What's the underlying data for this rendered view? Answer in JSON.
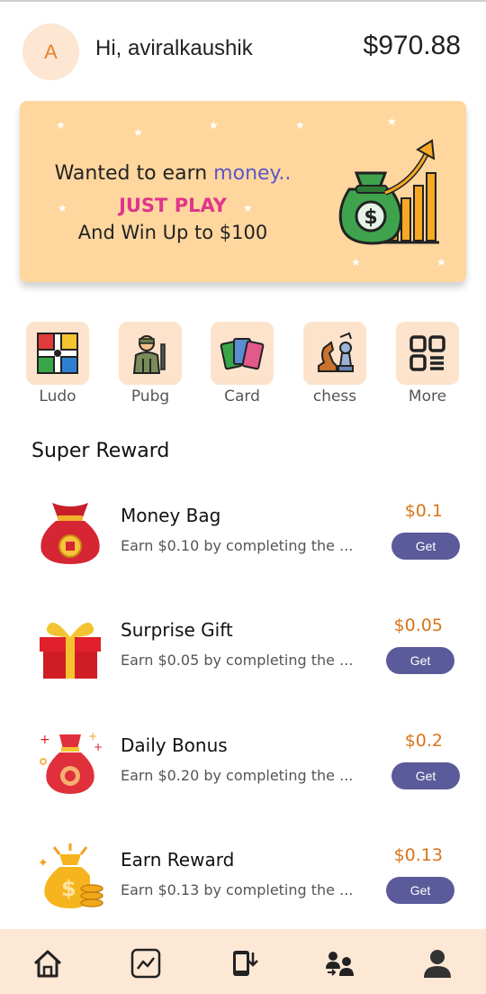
{
  "header": {
    "avatar_letter": "A",
    "greeting": "Hi, aviralkaushik",
    "balance": "$970.88"
  },
  "banner": {
    "line1_prefix": "Wanted to earn ",
    "line1_highlight": "money..",
    "line2": "JUST PLAY",
    "line3": "And Win Up to $100"
  },
  "categories": [
    {
      "label": "Ludo",
      "icon": "ludo-icon"
    },
    {
      "label": "Pubg",
      "icon": "pubg-icon"
    },
    {
      "label": "Card",
      "icon": "card-icon"
    },
    {
      "label": "chess",
      "icon": "chess-icon"
    },
    {
      "label": "More",
      "icon": "grid-icon"
    }
  ],
  "section_title": "Super Reward",
  "rewards": [
    {
      "title": "Money Bag",
      "desc": "Earn $0.10 by completing the ...",
      "amount": "$0.1",
      "button": "Get",
      "icon": "money-bag-icon"
    },
    {
      "title": "Surprise Gift",
      "desc": "Earn $0.05 by completing the ...",
      "amount": "$0.05",
      "button": "Get",
      "icon": "gift-icon"
    },
    {
      "title": "Daily Bonus",
      "desc": "Earn $0.20 by completing the ...",
      "amount": "$0.2",
      "button": "Get",
      "icon": "bonus-bag-icon"
    },
    {
      "title": "Earn Reward",
      "desc": "Earn $0.13 by completing the ...",
      "amount": "$0.13",
      "button": "Get",
      "icon": "coin-bag-icon"
    }
  ],
  "nav": [
    "home-icon",
    "chart-icon",
    "download-phone-icon",
    "transfer-users-icon",
    "profile-icon"
  ],
  "colors": {
    "accent": "#5b5a9a",
    "amount": "#d9741b",
    "banner_bg": "#ffd79e",
    "nav_bg": "#fde8d6",
    "tile_bg": "#fde3cc"
  }
}
